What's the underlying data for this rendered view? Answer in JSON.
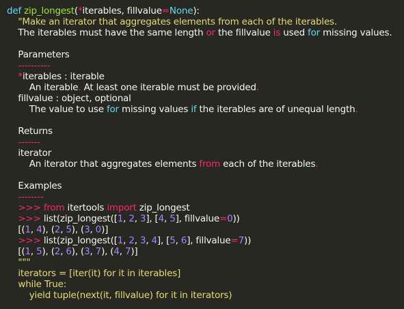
{
  "editor": {
    "theme_colors": {
      "background": "#272822",
      "plain": "#f8f8f2",
      "keyword": "#66d9ef",
      "function": "#a6e22e",
      "string": "#e6db74",
      "operator": "#f92672",
      "number": "#ae81ff"
    },
    "lines": [
      {
        "tokens": [
          {
            "t": "def ",
            "c": "kw"
          },
          {
            "t": "zip_longest",
            "c": "fn"
          },
          {
            "t": "(",
            "c": "plain"
          },
          {
            "t": "*",
            "c": "mag"
          },
          {
            "t": "iterables, fillvalue",
            "c": "plain"
          },
          {
            "t": "=",
            "c": "mag"
          },
          {
            "t": "None",
            "c": "kw"
          },
          {
            "t": "):",
            "c": "plain"
          }
        ]
      },
      {
        "tokens": [
          {
            "t": "    \"Make an iterator that aggregates elements from each of the iterables.",
            "c": "str"
          }
        ]
      },
      {
        "tokens": [
          {
            "t": "    The iterables must have the same length ",
            "c": "plain"
          },
          {
            "t": "or",
            "c": "mag"
          },
          {
            "t": " the fillvalue ",
            "c": "plain"
          },
          {
            "t": "is",
            "c": "mag"
          },
          {
            "t": " used ",
            "c": "plain"
          },
          {
            "t": "for",
            "c": "kw"
          },
          {
            "t": " missing values.",
            "c": "plain"
          }
        ]
      },
      {
        "blank": true
      },
      {
        "tokens": [
          {
            "t": "    Parameters",
            "c": "plain"
          }
        ]
      },
      {
        "tokens": [
          {
            "t": "    ----------",
            "c": "mag"
          }
        ]
      },
      {
        "tokens": [
          {
            "t": "    ",
            "c": "plain"
          },
          {
            "t": "*",
            "c": "mag"
          },
          {
            "t": "iterables : iterable",
            "c": "plain"
          }
        ]
      },
      {
        "tokens": [
          {
            "t": "        An iterable",
            "c": "plain"
          },
          {
            "t": ".",
            "c": "mag"
          },
          {
            "t": " At least one iterable must be provided",
            "c": "plain"
          },
          {
            "t": ".",
            "c": "mag"
          }
        ]
      },
      {
        "tokens": [
          {
            "t": "    fillvalue : object, optional",
            "c": "plain"
          }
        ]
      },
      {
        "tokens": [
          {
            "t": "        The value to use ",
            "c": "plain"
          },
          {
            "t": "for",
            "c": "kw"
          },
          {
            "t": " missing values ",
            "c": "plain"
          },
          {
            "t": "if",
            "c": "kw"
          },
          {
            "t": " the iterables are of unequal length",
            "c": "plain"
          },
          {
            "t": ".",
            "c": "mag"
          }
        ]
      },
      {
        "blank": true
      },
      {
        "tokens": [
          {
            "t": "    Returns",
            "c": "plain"
          }
        ]
      },
      {
        "tokens": [
          {
            "t": "    -------",
            "c": "mag"
          }
        ]
      },
      {
        "tokens": [
          {
            "t": "    iterator",
            "c": "plain"
          }
        ]
      },
      {
        "tokens": [
          {
            "t": "        An iterator that aggregates elements ",
            "c": "plain"
          },
          {
            "t": "from",
            "c": "mag"
          },
          {
            "t": " each of the iterables",
            "c": "plain"
          },
          {
            "t": ".",
            "c": "mag"
          }
        ]
      },
      {
        "blank": true
      },
      {
        "tokens": [
          {
            "t": "    Examples",
            "c": "plain"
          }
        ]
      },
      {
        "tokens": [
          {
            "t": "    --------",
            "c": "mag"
          }
        ]
      },
      {
        "tokens": [
          {
            "t": "    ",
            "c": "plain"
          },
          {
            "t": ">>> ",
            "c": "mag"
          },
          {
            "t": "from",
            "c": "mag"
          },
          {
            "t": " itertools ",
            "c": "plain"
          },
          {
            "t": "import",
            "c": "mag"
          },
          {
            "t": " zip_longest",
            "c": "plain"
          }
        ]
      },
      {
        "tokens": [
          {
            "t": "    ",
            "c": "plain"
          },
          {
            "t": ">>> ",
            "c": "mag"
          },
          {
            "t": "list(zip_longest([",
            "c": "plain"
          },
          {
            "t": "1",
            "c": "num"
          },
          {
            "t": ", ",
            "c": "plain"
          },
          {
            "t": "2",
            "c": "num"
          },
          {
            "t": ", ",
            "c": "plain"
          },
          {
            "t": "3",
            "c": "num"
          },
          {
            "t": "], [",
            "c": "plain"
          },
          {
            "t": "4",
            "c": "num"
          },
          {
            "t": ", ",
            "c": "plain"
          },
          {
            "t": "5",
            "c": "num"
          },
          {
            "t": "], fillvalue",
            "c": "plain"
          },
          {
            "t": "=",
            "c": "mag"
          },
          {
            "t": "0",
            "c": "num"
          },
          {
            "t": "))",
            "c": "plain"
          }
        ]
      },
      {
        "tokens": [
          {
            "t": "    [(",
            "c": "plain"
          },
          {
            "t": "1",
            "c": "num"
          },
          {
            "t": ", ",
            "c": "plain"
          },
          {
            "t": "4",
            "c": "num"
          },
          {
            "t": "), (",
            "c": "plain"
          },
          {
            "t": "2",
            "c": "num"
          },
          {
            "t": ", ",
            "c": "plain"
          },
          {
            "t": "5",
            "c": "num"
          },
          {
            "t": "), (",
            "c": "plain"
          },
          {
            "t": "3",
            "c": "num"
          },
          {
            "t": ", ",
            "c": "plain"
          },
          {
            "t": "0",
            "c": "num"
          },
          {
            "t": ")]",
            "c": "plain"
          }
        ]
      },
      {
        "tokens": [
          {
            "t": "    ",
            "c": "plain"
          },
          {
            "t": ">>> ",
            "c": "mag"
          },
          {
            "t": "list(zip_longest([",
            "c": "plain"
          },
          {
            "t": "1",
            "c": "num"
          },
          {
            "t": ", ",
            "c": "plain"
          },
          {
            "t": "2",
            "c": "num"
          },
          {
            "t": ", ",
            "c": "plain"
          },
          {
            "t": "3",
            "c": "num"
          },
          {
            "t": ", ",
            "c": "plain"
          },
          {
            "t": "4",
            "c": "num"
          },
          {
            "t": "], [",
            "c": "plain"
          },
          {
            "t": "5",
            "c": "num"
          },
          {
            "t": ", ",
            "c": "plain"
          },
          {
            "t": "6",
            "c": "num"
          },
          {
            "t": "], fillvalue",
            "c": "plain"
          },
          {
            "t": "=",
            "c": "mag"
          },
          {
            "t": "7",
            "c": "num"
          },
          {
            "t": "))",
            "c": "plain"
          }
        ]
      },
      {
        "tokens": [
          {
            "t": "    [(",
            "c": "plain"
          },
          {
            "t": "1",
            "c": "num"
          },
          {
            "t": ", ",
            "c": "plain"
          },
          {
            "t": "5",
            "c": "num"
          },
          {
            "t": "), (",
            "c": "plain"
          },
          {
            "t": "2",
            "c": "num"
          },
          {
            "t": ", ",
            "c": "plain"
          },
          {
            "t": "6",
            "c": "num"
          },
          {
            "t": "), (",
            "c": "plain"
          },
          {
            "t": "3",
            "c": "num"
          },
          {
            "t": ", ",
            "c": "plain"
          },
          {
            "t": "7",
            "c": "num"
          },
          {
            "t": "), (",
            "c": "plain"
          },
          {
            "t": "4",
            "c": "num"
          },
          {
            "t": ", ",
            "c": "plain"
          },
          {
            "t": "7",
            "c": "num"
          },
          {
            "t": ")]",
            "c": "plain"
          }
        ]
      },
      {
        "tokens": [
          {
            "t": "    \"\"\"",
            "c": "str"
          }
        ]
      },
      {
        "tokens": [
          {
            "t": "    iterators ",
            "c": "str"
          },
          {
            "t": "=",
            "c": "str"
          },
          {
            "t": " [iter(it) for it in iterables]",
            "c": "str"
          }
        ]
      },
      {
        "tokens": [
          {
            "t": "    while True:",
            "c": "str"
          }
        ]
      },
      {
        "tokens": [
          {
            "t": "        yield tuple(next(it, fillvalue) for it in iterators)",
            "c": "str"
          }
        ]
      }
    ]
  }
}
